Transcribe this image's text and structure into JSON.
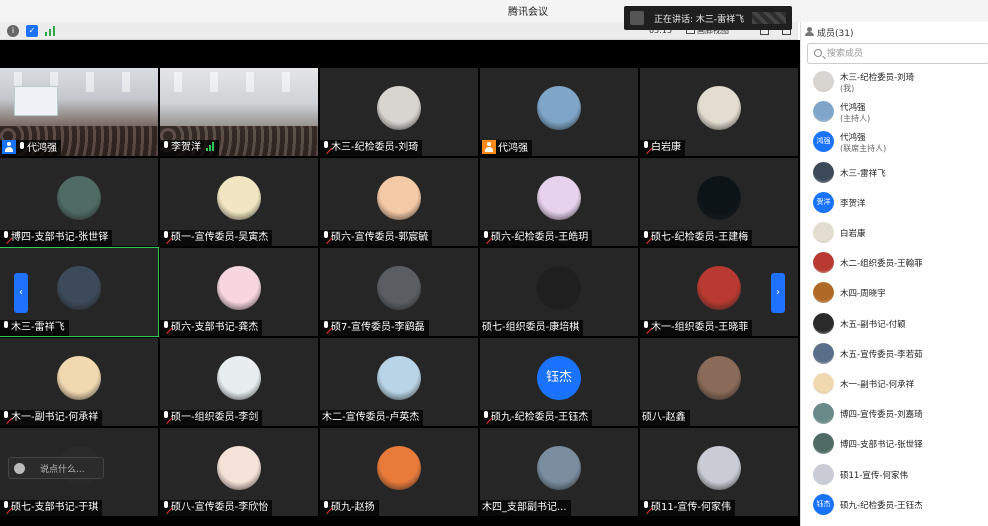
{
  "window": {
    "title": "腾讯会议"
  },
  "toolbar": {
    "timer": "05:15",
    "view_label": "画廊视图"
  },
  "speaking": {
    "text": "正在讲话: 木三-雷祥飞"
  },
  "gallery": {
    "tiles": [
      {
        "name": "代鸿强",
        "kind": "photo",
        "mic": "on",
        "host": "blue"
      },
      {
        "name": "李贺洋",
        "kind": "photo2",
        "mic": "on",
        "volume": true
      },
      {
        "name": "木三-纪检委员-刘琦",
        "kind": "avatar",
        "mic": "off",
        "color": "#d8d4d0"
      },
      {
        "name": "代鸿强",
        "kind": "avatar",
        "mic": "none",
        "host": "orange",
        "color": "#7fa6c9"
      },
      {
        "name": "白岩康",
        "kind": "avatar",
        "mic": "off",
        "color": "#e3dcd0"
      },
      {
        "name": "博四-支部书记-张世铎",
        "kind": "avatar",
        "mic": "off",
        "color": "#4f6b63"
      },
      {
        "name": "硕一-宣传委员-吴寅杰",
        "kind": "avatar",
        "mic": "off",
        "color": "#f2e6c2"
      },
      {
        "name": "硕六-宣传委员-郭宸毓",
        "kind": "avatar",
        "mic": "off",
        "color": "#f4c9a6"
      },
      {
        "name": "硕六-纪检委员-王皓玥",
        "kind": "avatar",
        "mic": "off",
        "color": "#e6d2ec"
      },
      {
        "name": "硕七-纪检委员-王建梅",
        "kind": "avatar",
        "mic": "off",
        "color": "#0d1418"
      },
      {
        "name": "木三-雷祥飞",
        "kind": "avatar",
        "mic": "on",
        "color": "#3d4a5a",
        "active": true
      },
      {
        "name": "硕六-支部书记-龚杰",
        "kind": "avatar",
        "mic": "off",
        "color": "#f7d6df"
      },
      {
        "name": "硕7-宣传委员-李鹞磊",
        "kind": "avatar",
        "mic": "off",
        "color": "#5a5e63"
      },
      {
        "name": "硕七-组织委员-康培棋",
        "kind": "avatar",
        "mic": "none",
        "color": "#1f1f1f"
      },
      {
        "name": "木一-组织委员-王晓菲",
        "kind": "avatar",
        "mic": "off",
        "color": "#b83a30"
      },
      {
        "name": "木一-副书记-何承祥",
        "kind": "avatar",
        "mic": "off",
        "color": "#f0d8b0"
      },
      {
        "name": "硕一-组织委员-李剑",
        "kind": "avatar",
        "mic": "off",
        "color": "#e8eef0"
      },
      {
        "name": "木二-宣传委员-卢英杰",
        "kind": "avatar",
        "mic": "none",
        "color": "#b9d4e6"
      },
      {
        "name": "硕九-纪检委员-王钰杰",
        "kind": "text",
        "mic": "off",
        "text": "钰杰"
      },
      {
        "name": "硕八-赵鑫",
        "kind": "avatar",
        "mic": "none",
        "color": "#8a6a58"
      },
      {
        "name": "硕七-支部书记-于琪",
        "kind": "avatar",
        "mic": "off",
        "color": "#2a2a2a"
      },
      {
        "name": "硕八-宣传委员-李欣怡",
        "kind": "avatar",
        "mic": "off",
        "color": "#f5e2d8"
      },
      {
        "name": "硕九-赵扬",
        "kind": "avatar",
        "mic": "off",
        "color": "#e87a3a"
      },
      {
        "name": "木四_支部副书记...",
        "kind": "avatar",
        "mic": "none",
        "color": "#7a8ea0"
      },
      {
        "name": "硕11-宣传-何家伟",
        "kind": "avatar",
        "mic": "off",
        "color": "#c9ccd4"
      }
    ]
  },
  "chat": {
    "placeholder": "说点什么..."
  },
  "members": {
    "header": "成员(31)",
    "search_placeholder": "搜索成员",
    "items": [
      {
        "name": "木三-纪检委员-刘琦",
        "role": "(我)",
        "color": "#d8d4d0"
      },
      {
        "name": "代鸿强",
        "role": "(主持人)",
        "color": "#7fa6c9"
      },
      {
        "name": "代鸿强",
        "role": "(联席主持人)",
        "avatar_text": "鸿强"
      },
      {
        "name": "木三-雷祥飞",
        "role": "",
        "color": "#3d4a5a"
      },
      {
        "name": "李贺洋",
        "role": "",
        "avatar_text": "贺洋"
      },
      {
        "name": "白岩康",
        "role": "",
        "color": "#e3dcd0"
      },
      {
        "name": "木二-组织委员-王翰菲",
        "role": "",
        "color": "#b83a30"
      },
      {
        "name": "木四-周晓宇",
        "role": "",
        "color": "#b06a28"
      },
      {
        "name": "木五-副书记-付颖",
        "role": "",
        "color": "#2a2a2a"
      },
      {
        "name": "木五-宣传委员-李若茹",
        "role": "",
        "color": "#5a6e8a"
      },
      {
        "name": "木一-副书记-何承祥",
        "role": "",
        "color": "#f0d8b0"
      },
      {
        "name": "博四-宣传委员-刘嘉琦",
        "role": "",
        "color": "#6a8a8a"
      },
      {
        "name": "博四-支部书记-张世铎",
        "role": "",
        "color": "#4f6b63"
      },
      {
        "name": "硕11-宣传-何家伟",
        "role": "",
        "color": "#c9ccd4"
      },
      {
        "name": "硕九-纪检委员-王钰杰",
        "role": "",
        "avatar_text": "钰杰"
      }
    ]
  }
}
